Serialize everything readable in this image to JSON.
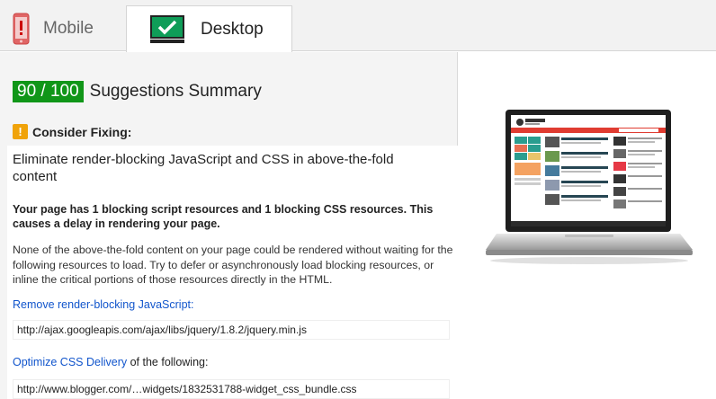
{
  "tabs": [
    {
      "label": "Mobile",
      "active": false
    },
    {
      "label": "Desktop",
      "active": true
    }
  ],
  "summary": {
    "score": "90 / 100",
    "title": "Suggestions Summary"
  },
  "consider": {
    "label": "Consider Fixing:"
  },
  "rule": {
    "title": "Eliminate render-blocking JavaScript and CSS in above-the-fold content",
    "bold_text": "Your page has 1 blocking script resources and 1 blocking CSS resources. This causes a delay in rendering your page.",
    "description": "None of the above-the-fold content on your page could be rendered without waiting for the following resources to load. Try to defer or asynchronously load blocking resources, or inline the critical portions of those resources directly in the HTML.",
    "js_link": "Remove render-blocking JavaScript:",
    "js_resource": "http://ajax.googleapis.com/ajax/libs/jquery/1.8.2/jquery.min.js",
    "css_link": "Optimize CSS Delivery",
    "css_suffix": " of the following:",
    "css_resource": "http://www.blogger.com/…widgets/1832531788-widget_css_bundle.css"
  },
  "colors": {
    "score_green": "#109618",
    "warning_orange": "#f0a30a",
    "link_blue": "#1155cc",
    "mobile_icon_red": "#e06666",
    "desktop_icon_green": "#0f9d58"
  }
}
